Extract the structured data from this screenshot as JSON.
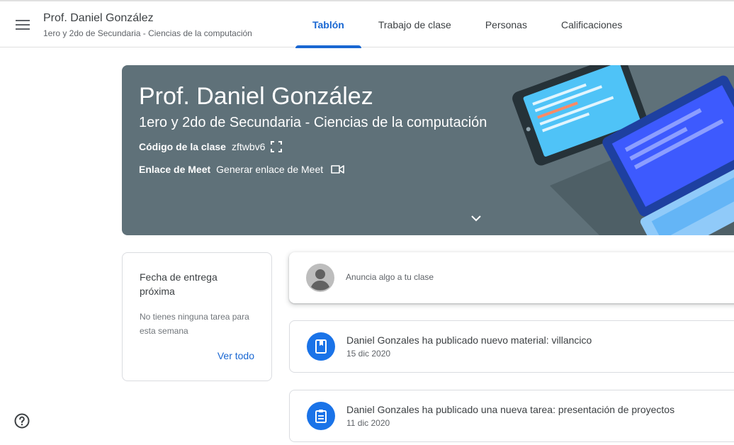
{
  "header": {
    "title": "Prof. Daniel González",
    "subtitle": "1ero y 2do de Secundaria - Ciencias de la computación",
    "tabs": [
      {
        "label": "Tablón",
        "active": true
      },
      {
        "label": "Trabajo de clase",
        "active": false
      },
      {
        "label": "Personas",
        "active": false
      },
      {
        "label": "Calificaciones",
        "active": false
      }
    ]
  },
  "banner": {
    "title": "Prof. Daniel González",
    "subtitle": "1ero y 2do de Secundaria - Ciencias de la computación",
    "class_code_label": "Código de la clase",
    "class_code": "zftwbv6",
    "meet_label": "Enlace de Meet",
    "meet_action": "Generar enlace de Meet",
    "background_color": "#5f7179"
  },
  "upcoming": {
    "title": "Fecha de entrega próxima",
    "message": "No tienes ninguna tarea para esta semana",
    "link": "Ver todo"
  },
  "announce": {
    "placeholder": "Anuncia algo a tu clase"
  },
  "posts": [
    {
      "text": "Daniel Gonzales ha publicado nuevo material: villancico",
      "date": "15 dic 2020",
      "icon": "material-book-icon"
    },
    {
      "text": "Daniel Gonzales ha publicado una nueva tarea: presentación de proyectos",
      "date": "11 dic 2020",
      "icon": "assignment-icon"
    }
  ],
  "colors": {
    "accent": "#1967d2",
    "post_icon_bg": "#1a73e8"
  }
}
